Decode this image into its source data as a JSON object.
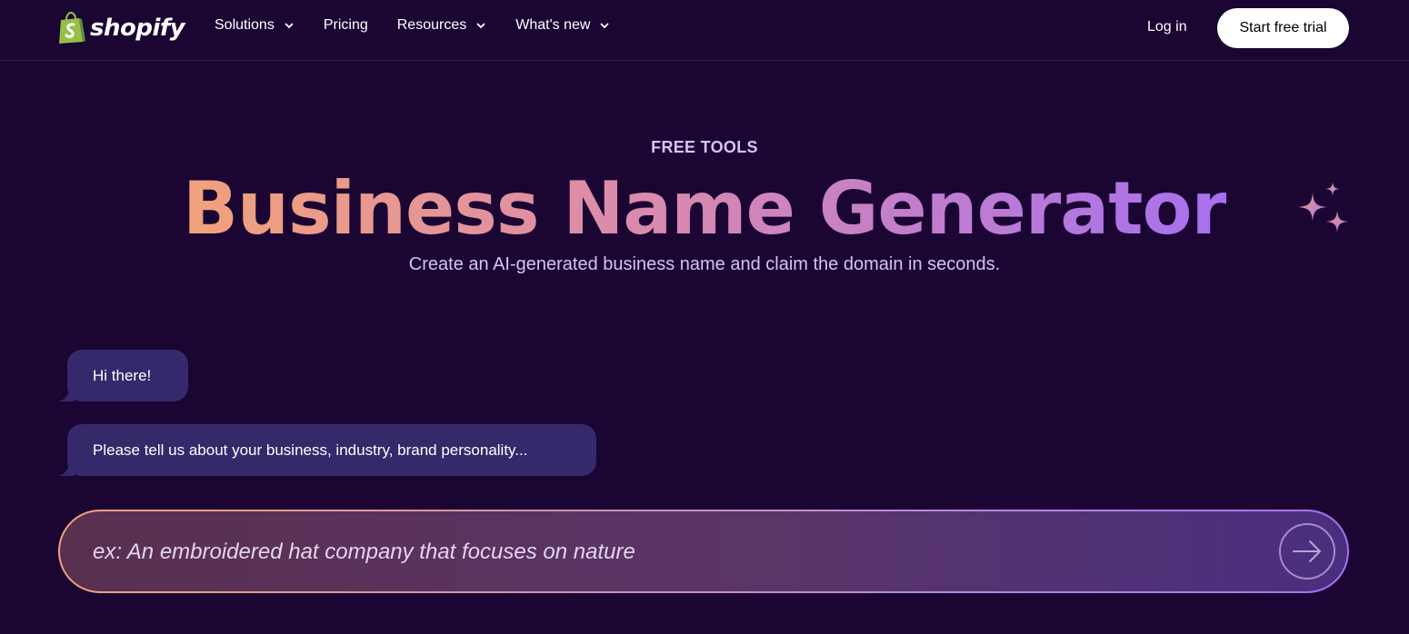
{
  "header": {
    "logo_text": "shopify",
    "nav": [
      {
        "label": "Solutions",
        "has_dropdown": true
      },
      {
        "label": "Pricing",
        "has_dropdown": false
      },
      {
        "label": "Resources",
        "has_dropdown": true
      },
      {
        "label": "What's new",
        "has_dropdown": true
      }
    ],
    "login_label": "Log in",
    "trial_label": "Start free trial"
  },
  "hero": {
    "eyebrow": "FREE TOOLS",
    "title": "Business Name Generator",
    "subtitle": "Create an AI-generated business name and claim the domain in seconds.",
    "sparkle_icon": "sparkle-icon"
  },
  "chat": {
    "messages": [
      {
        "text": "Hi there!"
      },
      {
        "text": "Please tell us about your business, industry, brand personality..."
      }
    ],
    "input": {
      "placeholder": "ex: An embroidered hat company that focuses on nature",
      "value": ""
    },
    "send_icon": "arrow-right-icon"
  },
  "colors": {
    "background": "#1a0533",
    "bubble": "#35296b",
    "accent_start": "#f2a27a",
    "accent_end": "#a770ef",
    "logo_bag": "#95bf47"
  }
}
